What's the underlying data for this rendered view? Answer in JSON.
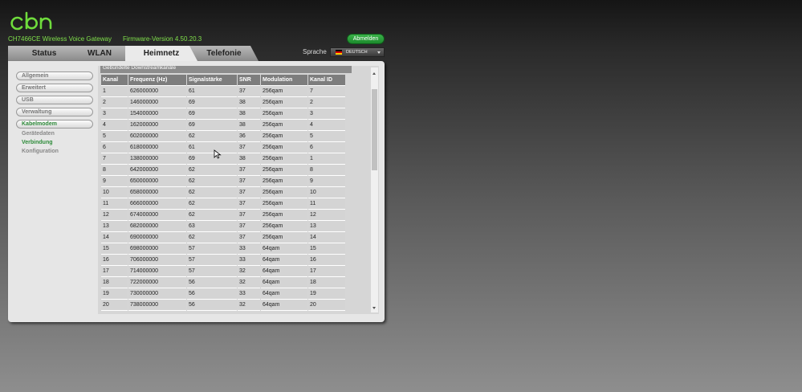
{
  "header": {
    "model": "CH7466CE  Wireless Voice Gateway",
    "firmware": "Firmware-Version  4.50.20.3",
    "logout_label": "Abmelden"
  },
  "tabs": [
    {
      "label": "Status"
    },
    {
      "label": "WLAN"
    },
    {
      "label": "Heimnetz"
    },
    {
      "label": "Telefonie"
    }
  ],
  "language": {
    "label": "Sprache",
    "selected": "DEUTSCH"
  },
  "sidebar": {
    "items": [
      {
        "label": "Allgemein"
      },
      {
        "label": "Erweitert"
      },
      {
        "label": "USB"
      },
      {
        "label": "Verwaltung"
      },
      {
        "label": "Kabelmodem"
      }
    ],
    "subitems": [
      {
        "label": "Gerätedaten"
      },
      {
        "label": "Verbindung"
      },
      {
        "label": "Konfiguration"
      }
    ]
  },
  "table": {
    "title": "Gebündelte Downstreamkanäle",
    "headers": [
      "Kanal",
      "Frequenz (Hz)",
      "Signalstärke",
      "SNR",
      "Modulation",
      "Kanal ID"
    ],
    "rows": [
      [
        "1",
        "626000000",
        "61",
        "37",
        "256qam",
        "7"
      ],
      [
        "2",
        "146000000",
        "69",
        "38",
        "256qam",
        "2"
      ],
      [
        "3",
        "154000000",
        "69",
        "38",
        "256qam",
        "3"
      ],
      [
        "4",
        "162000000",
        "69",
        "38",
        "256qam",
        "4"
      ],
      [
        "5",
        "602000000",
        "62",
        "36",
        "256qam",
        "5"
      ],
      [
        "6",
        "618000000",
        "61",
        "37",
        "256qam",
        "6"
      ],
      [
        "7",
        "138000000",
        "69",
        "38",
        "256qam",
        "1"
      ],
      [
        "8",
        "642000000",
        "62",
        "37",
        "256qam",
        "8"
      ],
      [
        "9",
        "650000000",
        "62",
        "37",
        "256qam",
        "9"
      ],
      [
        "10",
        "658000000",
        "62",
        "37",
        "256qam",
        "10"
      ],
      [
        "11",
        "666000000",
        "62",
        "37",
        "256qam",
        "11"
      ],
      [
        "12",
        "674000000",
        "62",
        "37",
        "256qam",
        "12"
      ],
      [
        "13",
        "682000000",
        "63",
        "37",
        "256qam",
        "13"
      ],
      [
        "14",
        "690000000",
        "62",
        "37",
        "256qam",
        "14"
      ],
      [
        "15",
        "698000000",
        "57",
        "33",
        "64qam",
        "15"
      ],
      [
        "16",
        "706000000",
        "57",
        "33",
        "64qam",
        "16"
      ],
      [
        "17",
        "714000000",
        "57",
        "32",
        "64qam",
        "17"
      ],
      [
        "18",
        "722000000",
        "56",
        "32",
        "64qam",
        "18"
      ],
      [
        "19",
        "730000000",
        "56",
        "33",
        "64qam",
        "19"
      ],
      [
        "20",
        "738000000",
        "56",
        "32",
        "64qam",
        "20"
      ]
    ]
  },
  "colors": {
    "accent": "#7fe04a",
    "active_green": "#2e8b3a",
    "logout_green": "#22962f"
  }
}
